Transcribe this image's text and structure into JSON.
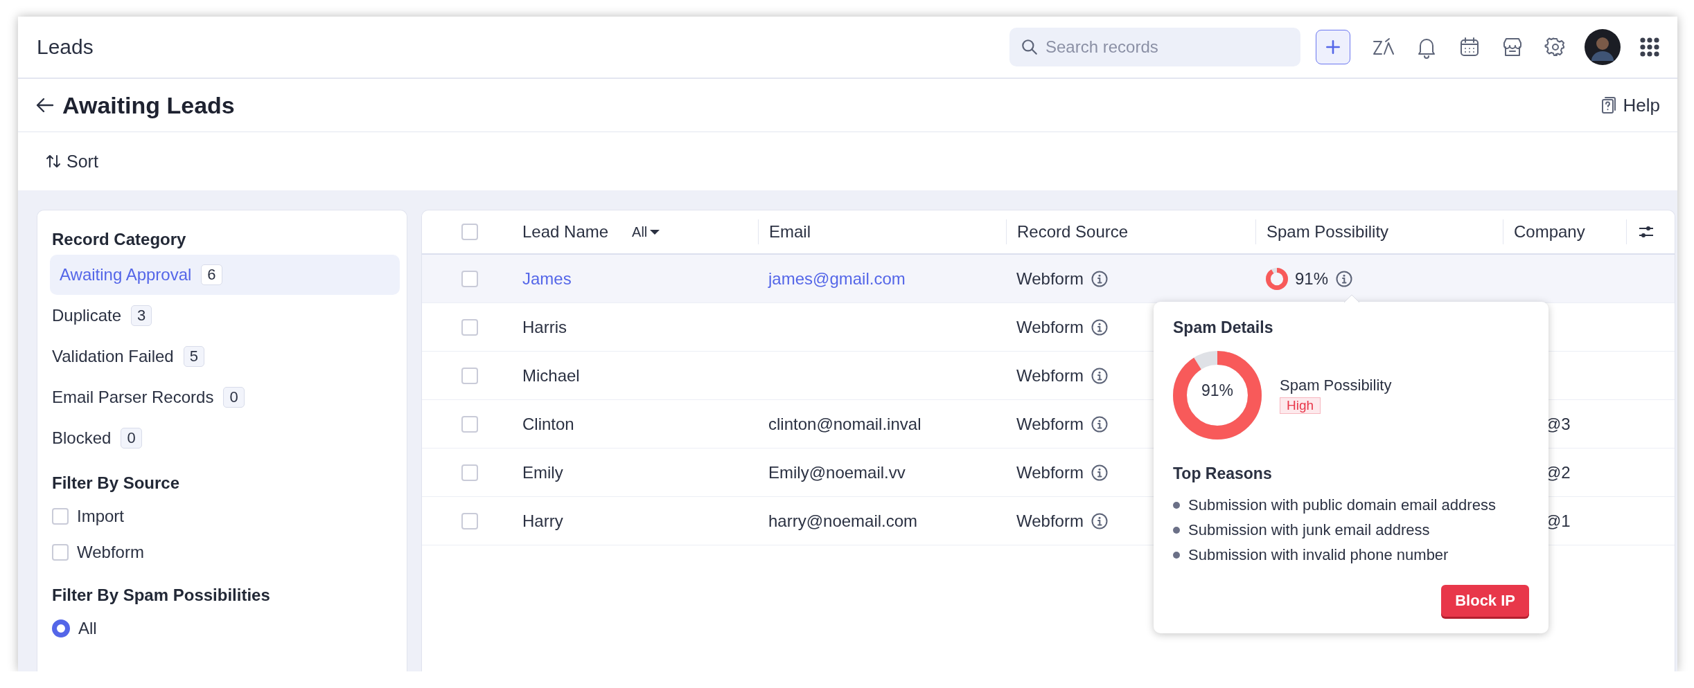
{
  "app": {
    "title": "Leads",
    "search": {
      "placeholder": "Search records"
    }
  },
  "page": {
    "title": "Awaiting Leads",
    "help": "Help",
    "sort": "Sort"
  },
  "sidebar": {
    "sections": [
      {
        "title": "Record Category",
        "kind": "categories",
        "items": [
          {
            "label": "Awaiting Approval",
            "count": "6",
            "selected": true
          },
          {
            "label": "Duplicate",
            "count": "3",
            "selected": false
          },
          {
            "label": "Validation Failed",
            "count": "5",
            "selected": false
          },
          {
            "label": "Email Parser Records",
            "count": "0",
            "selected": false
          },
          {
            "label": "Blocked",
            "count": "0",
            "selected": false
          }
        ]
      },
      {
        "title": "Filter By Source",
        "kind": "checkboxes",
        "items": [
          {
            "label": "Import",
            "checked": false
          },
          {
            "label": "Webform",
            "checked": false
          }
        ]
      },
      {
        "title": "Filter By Spam Possibilities",
        "kind": "radios",
        "items": [
          {
            "label": "All",
            "selected": true
          }
        ]
      }
    ]
  },
  "table": {
    "all_checked": false,
    "columns": [
      "Lead Name",
      "Email",
      "Record Source",
      "Spam Possibility",
      "Company"
    ],
    "name_filter": "All",
    "rows": [
      {
        "name": "James",
        "email": "james@gmail.com",
        "source": "Webform",
        "spam": {
          "level": 0.91,
          "reading": "91%"
        },
        "hovered": true,
        "checked": false
      },
      {
        "name": "Harris",
        "source": "Webform",
        "hovered": false,
        "checked": false
      },
      {
        "name": "Michael",
        "source": "Webform",
        "hovered": false,
        "checked": false
      },
      {
        "name": "Clinton",
        "email": "clinton@nomail.inval",
        "source": "Webform",
        "company": "@3",
        "hovered": false,
        "checked": false
      },
      {
        "name": "Emily",
        "email": "Emily@noemail.vv",
        "source": "Webform",
        "company": "@2",
        "hovered": false,
        "checked": false
      },
      {
        "name": "Harry",
        "email": "harry@noemail.com",
        "source": "Webform",
        "company": "@1",
        "hovered": false,
        "checked": false
      }
    ]
  },
  "spam_details": {
    "title": "Spam Details",
    "level": 0.91,
    "reading": "91%",
    "label": "Spam Possibility",
    "rating": "High",
    "reasons_title": "Top Reasons",
    "reasons": [
      "Submission with public domain email address",
      "Submission with junk email address",
      "Submission with invalid phone number"
    ],
    "button": "Block IP"
  }
}
